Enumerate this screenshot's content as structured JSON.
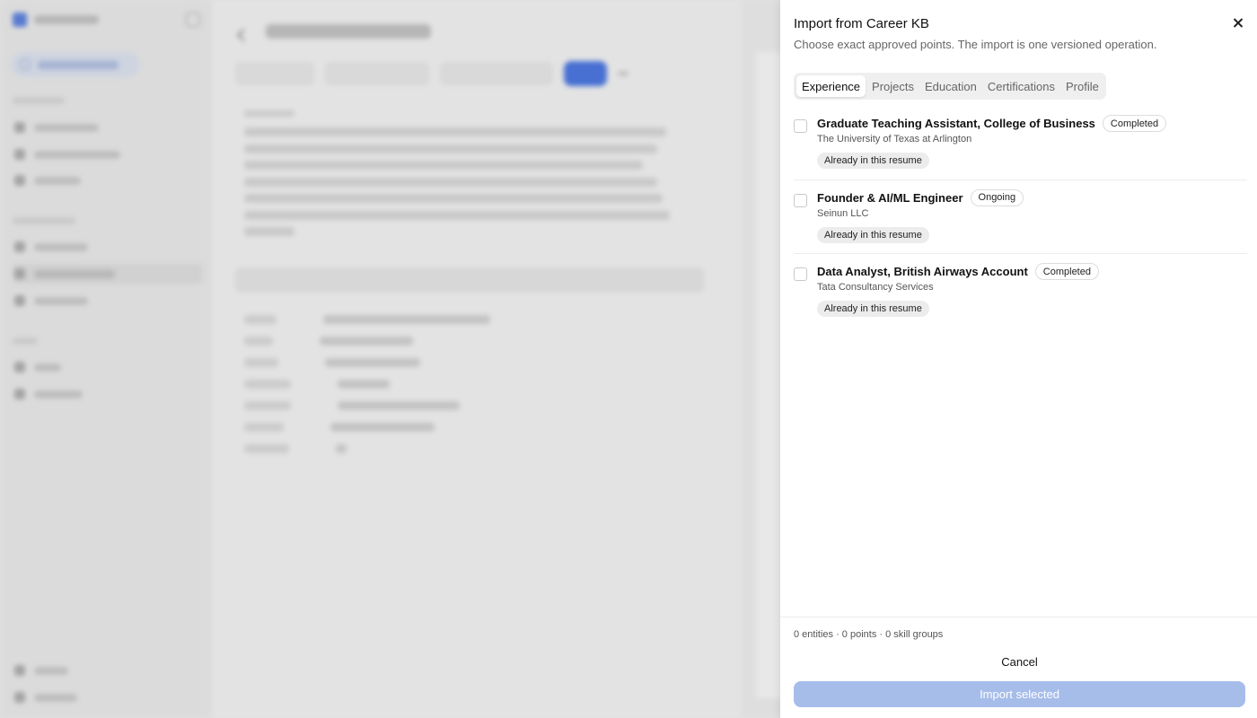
{
  "modal": {
    "title": "Import from Career KB",
    "subtitle": "Choose exact approved points. The import is one versioned operation.",
    "tabs": [
      {
        "label": "Experience",
        "active": true
      },
      {
        "label": "Projects",
        "active": false
      },
      {
        "label": "Education",
        "active": false
      },
      {
        "label": "Certifications",
        "active": false
      },
      {
        "label": "Profile",
        "active": false
      }
    ],
    "items": [
      {
        "title": "Graduate Teaching Assistant, College of Business",
        "status": "Completed",
        "organization": "The University of Texas at Arlington",
        "note": "Already in this resume",
        "checked": false
      },
      {
        "title": "Founder & AI/ML Engineer",
        "status": "Ongoing",
        "organization": "Seinun LLC",
        "note": "Already in this resume",
        "checked": false
      },
      {
        "title": "Data Analyst, British Airways Account",
        "status": "Completed",
        "organization": "Tata Consultancy Services",
        "note": "Already in this resume",
        "checked": false
      }
    ],
    "footer": {
      "summary": "0 entities · 0 points · 0 skill groups",
      "cancel_label": "Cancel",
      "import_label": "Import selected"
    }
  },
  "colors": {
    "import_button_disabled": "#a6bdea",
    "background_accent": "#4a74d9"
  }
}
